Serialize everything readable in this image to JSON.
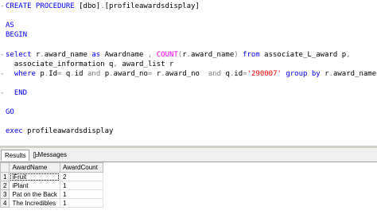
{
  "editor": {
    "lines": [
      {
        "gutter": "-",
        "tokens": [
          [
            "kw",
            "CREATE PROCEDURE "
          ],
          [
            "id",
            "[dbo]"
          ],
          [
            "op",
            "."
          ],
          [
            "id",
            "[profileawardsdisplay]"
          ]
        ]
      },
      {
        "gutter": "",
        "tokens": []
      },
      {
        "gutter": "",
        "tokens": [
          [
            "kw",
            "AS"
          ]
        ]
      },
      {
        "gutter": "",
        "tokens": [
          [
            "kw",
            "BEGIN"
          ]
        ]
      },
      {
        "gutter": "",
        "tokens": []
      },
      {
        "gutter": "-",
        "tokens": [
          [
            "kw",
            "select "
          ],
          [
            "id",
            "r"
          ],
          [
            "op",
            "."
          ],
          [
            "id",
            "award_name "
          ],
          [
            "kw",
            "as "
          ],
          [
            "id",
            "Awardname "
          ],
          [
            "op",
            ", "
          ],
          [
            "fn",
            "COUNT"
          ],
          [
            "op",
            "("
          ],
          [
            "id",
            "r"
          ],
          [
            "op",
            "."
          ],
          [
            "id",
            "award_name"
          ],
          [
            "op",
            ") "
          ],
          [
            "kw",
            "from "
          ],
          [
            "id",
            "associate_L_award p"
          ],
          [
            "op",
            ","
          ]
        ]
      },
      {
        "gutter": "",
        "tokens": [
          [
            "id",
            "  associate_information q"
          ],
          [
            "op",
            ", "
          ],
          [
            "id",
            "award_list r"
          ]
        ]
      },
      {
        "gutter": "-",
        "tokens": [
          [
            "kw",
            "  where "
          ],
          [
            "id",
            "p"
          ],
          [
            "op",
            "."
          ],
          [
            "id",
            "Id"
          ],
          [
            "op",
            "= "
          ],
          [
            "id",
            "q"
          ],
          [
            "op",
            "."
          ],
          [
            "id",
            "id "
          ],
          [
            "op",
            "and "
          ],
          [
            "id",
            "p"
          ],
          [
            "op",
            "."
          ],
          [
            "id",
            "award_no"
          ],
          [
            "op",
            "= "
          ],
          [
            "id",
            "r"
          ],
          [
            "op",
            "."
          ],
          [
            "id",
            "award_no  "
          ],
          [
            "op",
            "and "
          ],
          [
            "id",
            "q"
          ],
          [
            "op",
            "."
          ],
          [
            "id",
            "id"
          ],
          [
            "op",
            "="
          ],
          [
            "str",
            "'290007'"
          ],
          [
            "kw",
            " group by "
          ],
          [
            "id",
            "r"
          ],
          [
            "op",
            "."
          ],
          [
            "id",
            "award_name"
          ]
        ]
      },
      {
        "gutter": "",
        "tokens": []
      },
      {
        "gutter": "-",
        "tokens": [
          [
            "kw",
            "  END"
          ]
        ]
      },
      {
        "gutter": "",
        "tokens": []
      },
      {
        "gutter": "",
        "tokens": [
          [
            "kw",
            "GO"
          ]
        ]
      },
      {
        "gutter": "",
        "tokens": []
      },
      {
        "gutter": "",
        "tokens": [
          [
            "kw",
            "exec "
          ],
          [
            "id",
            "profileawardsdisplay"
          ]
        ]
      }
    ]
  },
  "results": {
    "tabs": [
      {
        "label": "Results"
      },
      {
        "label": "Messages"
      }
    ],
    "columns": [
      "AwardName",
      "AwardCount"
    ],
    "rows": [
      {
        "num": "1",
        "name": "iFruit",
        "count": "2"
      },
      {
        "num": "2",
        "name": "iPlant",
        "count": "1"
      },
      {
        "num": "3",
        "name": "Pat on the Back",
        "count": "1"
      },
      {
        "num": "4",
        "name": "The Incredibles",
        "count": "1"
      }
    ]
  }
}
